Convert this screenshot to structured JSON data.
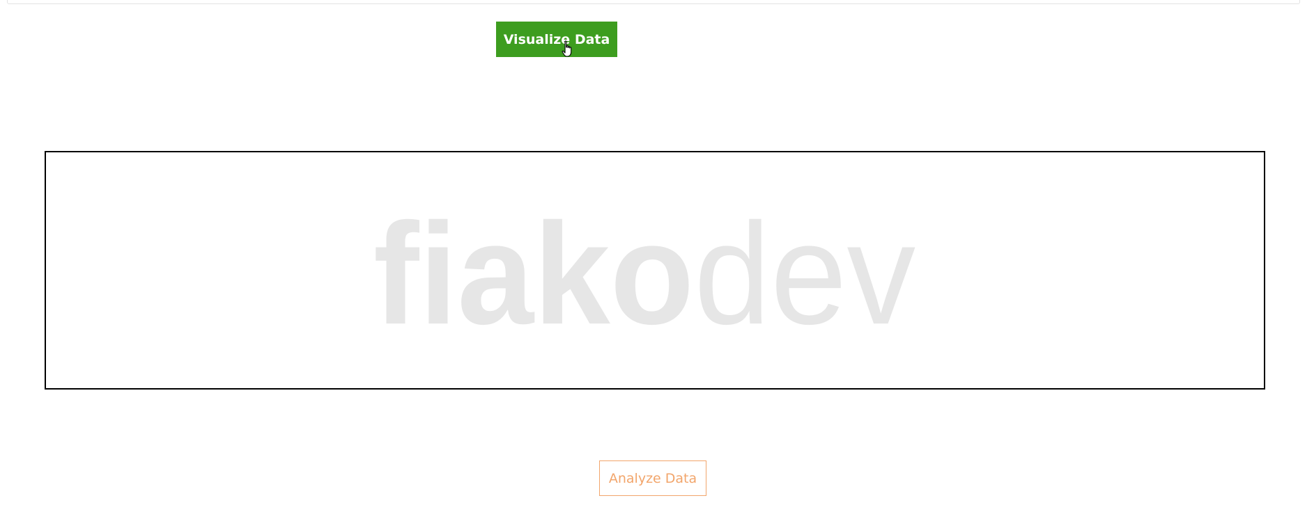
{
  "actions": {
    "visualize_label": "Visualize Data",
    "analyze_label": "Analyze Data"
  },
  "logo": {
    "bold_part": "fiako",
    "light_part": "dev"
  },
  "colors": {
    "visualize_bg": "#3d9d1f",
    "analyze_accent": "#f2a56b",
    "logo_text": "#e6e6e6"
  },
  "icons": {
    "cursor": "hand-pointer-icon"
  }
}
